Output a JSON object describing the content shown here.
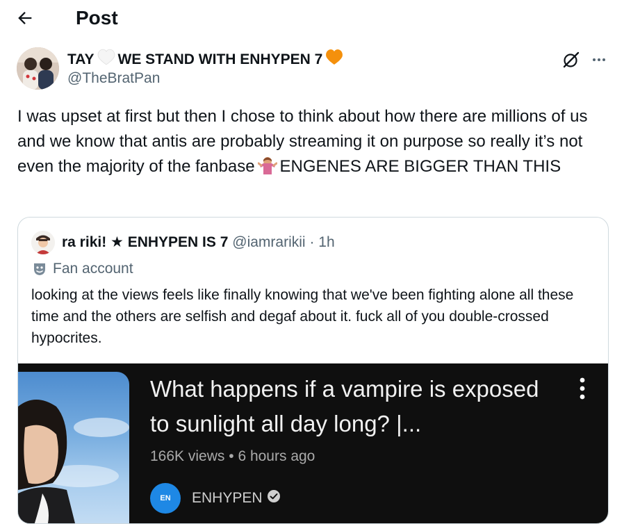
{
  "header": {
    "title": "Post",
    "back_icon": "arrow-left-icon"
  },
  "post": {
    "author": {
      "name_part1": "TAY",
      "name_part2": "WE STAND WITH ENHYPEN 7",
      "handle": "@TheBratPan",
      "heart_white_color": "#f5f5f5",
      "heart_orange_color": "#f4900c"
    },
    "text": "I was upset at first but then I chose to think about how there are millions of us and we know that antis are probably streaming it on purpose so really it’s not even the majority of the fanbase",
    "text_tail": "ENGENES ARE BIGGER THAN THIS",
    "icons": {
      "grok": "grok-icon",
      "more": "more-horizontal-icon"
    }
  },
  "quote": {
    "name": "ra riki! ★ ENHYPEN IS 7",
    "handle": "@iamrarikii",
    "dot": "·",
    "time": "1h",
    "label": "Fan account",
    "text": "looking at the views feels like finally knowing that we've been fighting alone all these time and the others are selfish and degaf about it. fuck all of you double-crossed hypocrites."
  },
  "video": {
    "title": "What happens if a vampire is exposed to sunlight all day long? |...",
    "views": "166K views",
    "dot": "•",
    "age": "6 hours ago",
    "channel": "ENHYPEN",
    "channel_logo_text": "EN",
    "accent": "#1e88e5"
  }
}
